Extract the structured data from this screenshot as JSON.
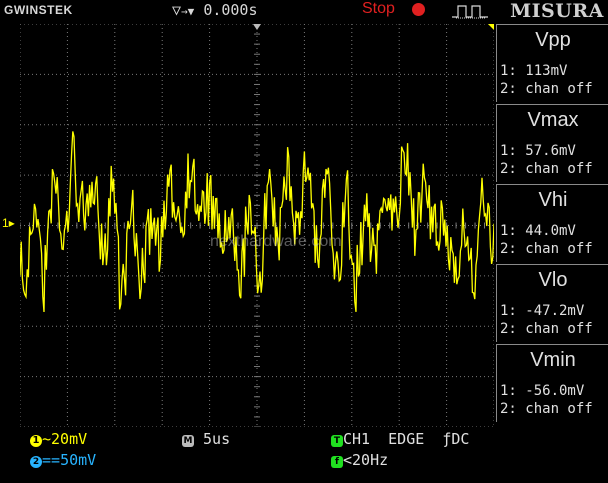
{
  "header": {
    "brand": "GWINSTEK",
    "trigger_delay": "0.000s",
    "run_state": "Stop",
    "menu_title": "MISURA"
  },
  "measurements": [
    {
      "name": "Vpp",
      "ch1": "1: 113mV",
      "ch2": "2: chan off"
    },
    {
      "name": "Vmax",
      "ch1": "1: 57.6mV",
      "ch2": "2: chan off"
    },
    {
      "name": "Vhi",
      "ch1": "1: 44.0mV",
      "ch2": "2: chan off"
    },
    {
      "name": "Vlo",
      "ch1": "1: -47.2mV",
      "ch2": "2: chan off"
    },
    {
      "name": "Vmin",
      "ch1": "1: -56.0mV",
      "ch2": "2: chan off"
    }
  ],
  "status": {
    "ch1_badge": "1",
    "ch1_coupling": "~",
    "ch1_scale": "20mV",
    "ch2_badge": "2",
    "ch2_coupling": "==",
    "ch2_scale": "50mV",
    "timebase_badge": "M",
    "timebase": "5us",
    "trigger_badge": "T",
    "trigger_source": "CH1",
    "trigger_type": "EDGE",
    "trigger_slope": "ƒ",
    "trigger_coupling": "DC",
    "freq_badge": "f",
    "frequency": "<20Hz"
  },
  "markers": {
    "ch1_marker": "1"
  },
  "watermark": "nexthardware.com",
  "colors": {
    "ch1": "#ffff00",
    "ch2": "#28b4ff",
    "grid": "#7a7a7a",
    "stop": "#e02020",
    "trigger": "#20e020"
  }
}
